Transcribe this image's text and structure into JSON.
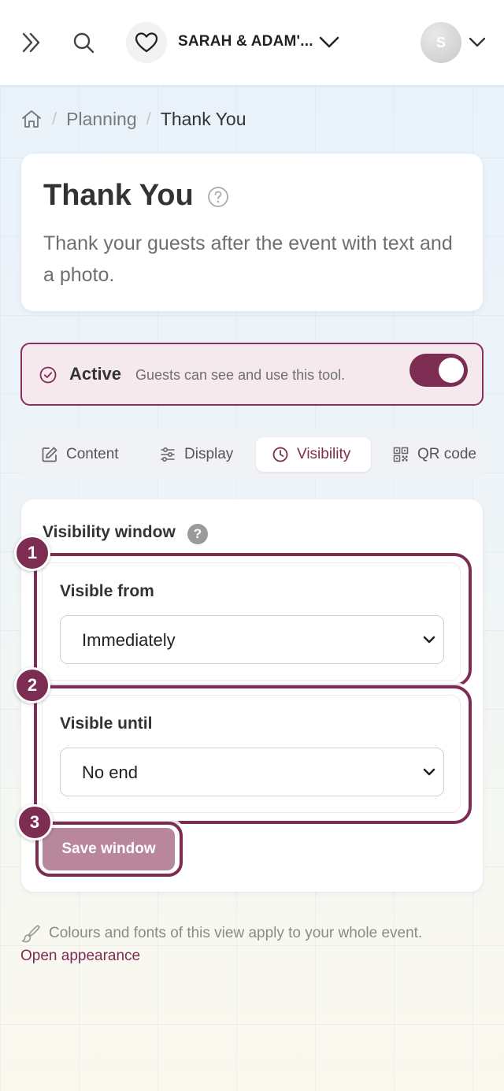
{
  "topbar": {
    "event_name": "SARAH & ADAM'...",
    "avatar_initial": "S"
  },
  "breadcrumb": {
    "items": [
      "Planning",
      "Thank You"
    ]
  },
  "page": {
    "title": "Thank You",
    "description": "Thank your guests after the event with text and a photo."
  },
  "status": {
    "label": "Active",
    "description": "Guests can see and use this tool.",
    "enabled": true
  },
  "tabs": [
    {
      "label": "Content",
      "icon": "edit-icon"
    },
    {
      "label": "Display",
      "icon": "sliders-icon"
    },
    {
      "label": "Visibility",
      "icon": "clock-icon",
      "selected": true
    },
    {
      "label": "QR code",
      "icon": "qr-icon"
    }
  ],
  "visibility": {
    "title": "Visibility window",
    "help": "?",
    "from_label": "Visible from",
    "from_value": "Immediately",
    "until_label": "Visible until",
    "until_value": "No end",
    "save_label": "Save window"
  },
  "annotations": [
    "1",
    "2",
    "3"
  ],
  "footer": {
    "note": "Colours and fonts of this view apply to your whole event.",
    "link": "Open appearance"
  },
  "colors": {
    "accent": "#7d2c52",
    "active_bg": "#f6e9ee",
    "save_button": "#b9879b"
  }
}
